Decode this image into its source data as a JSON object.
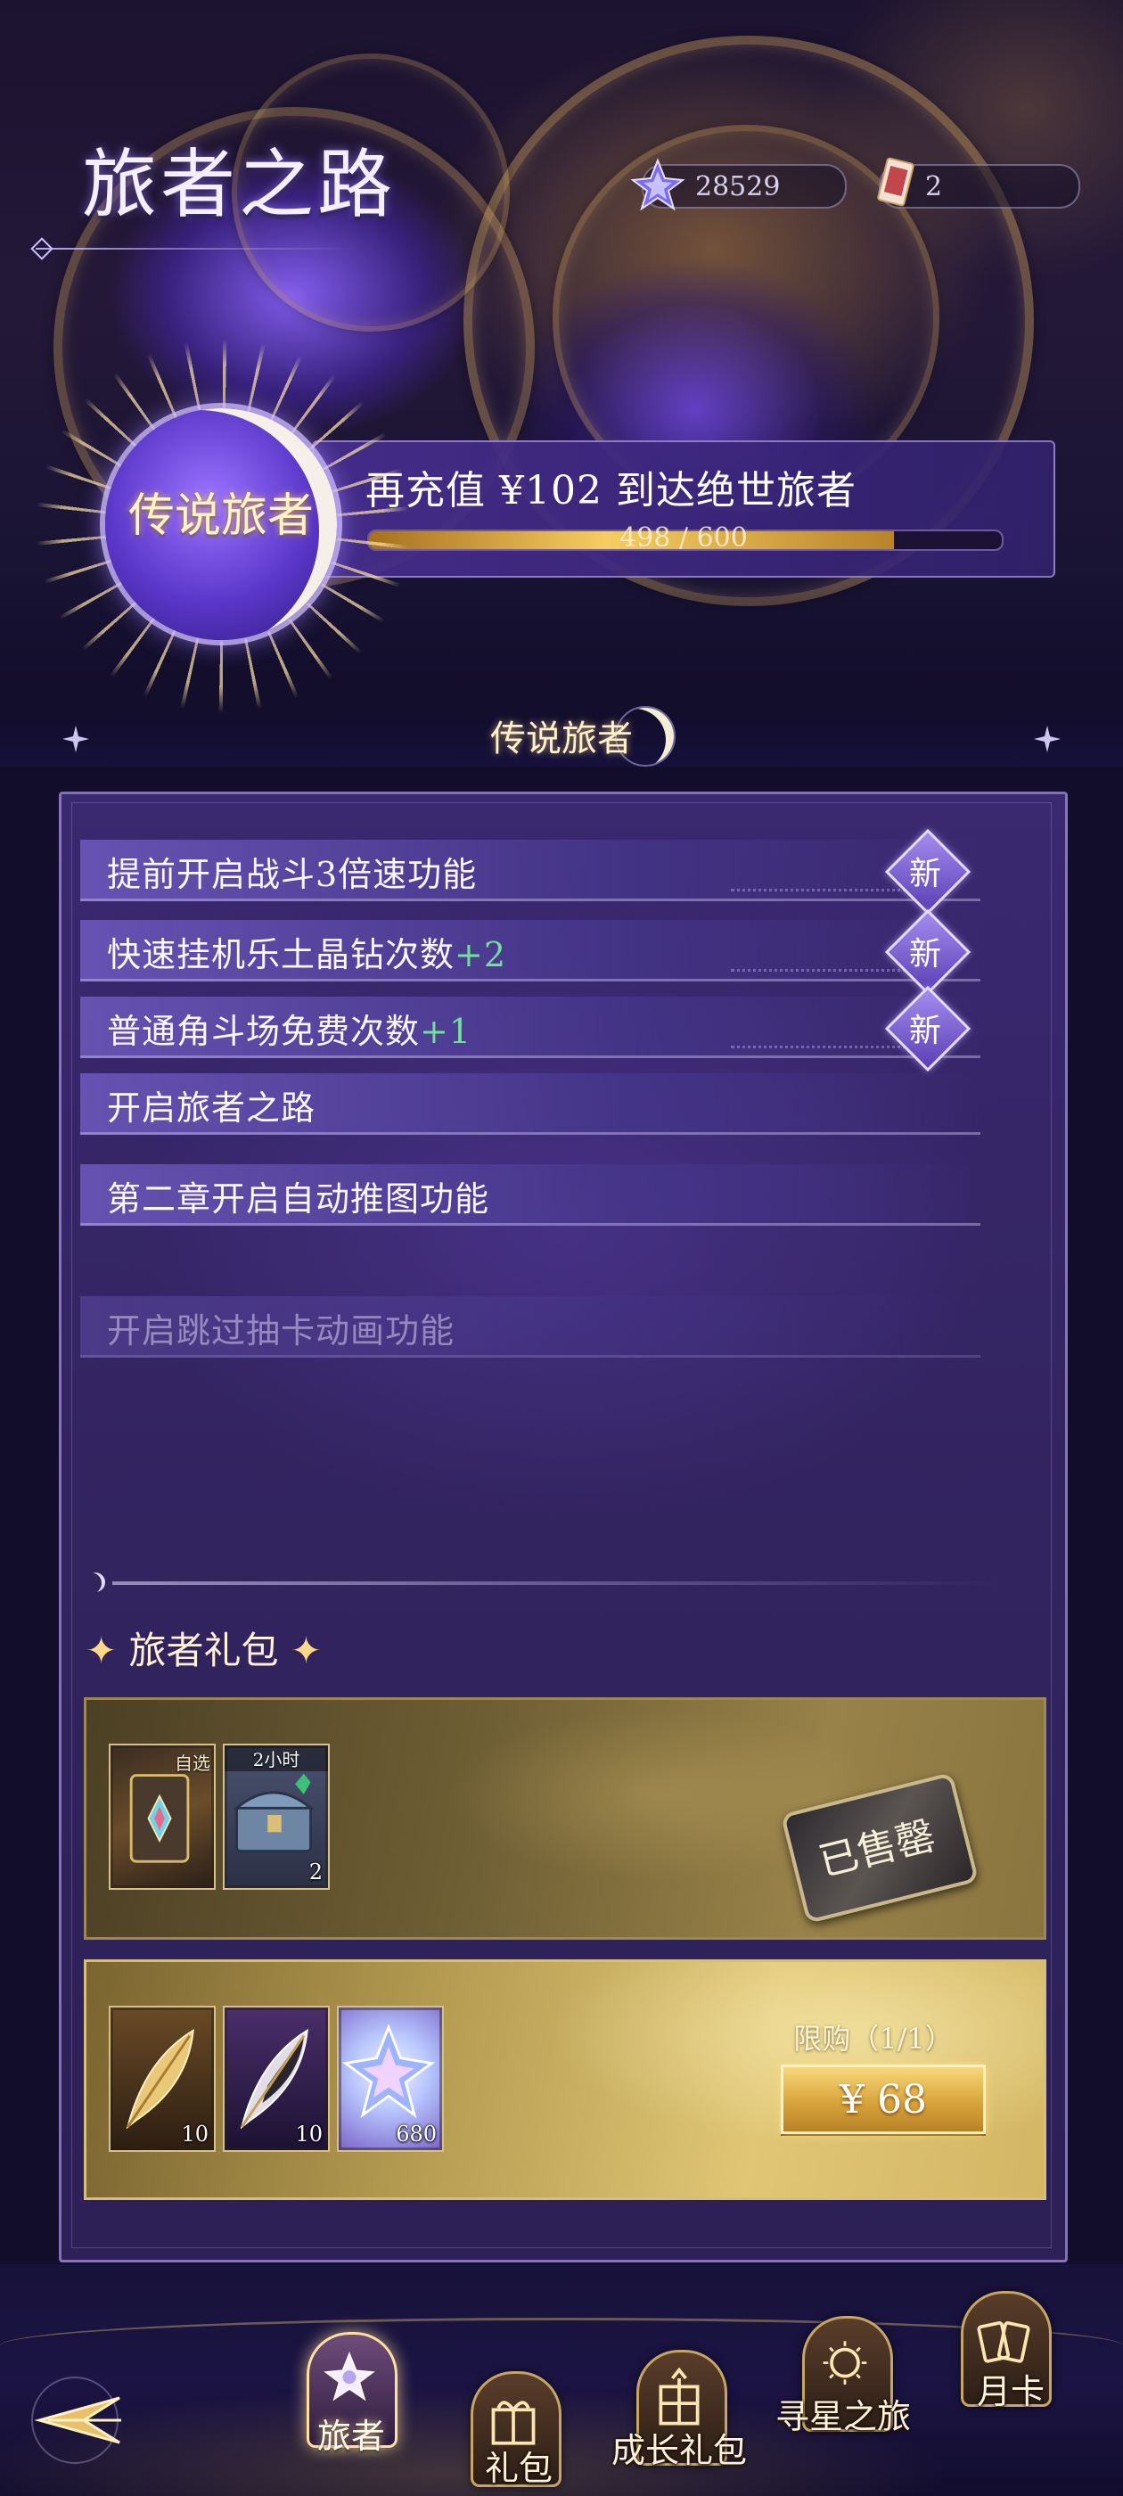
{
  "header": {
    "title": "旅者之路",
    "currencies": [
      {
        "icon": "star-gem-icon",
        "value": "28529"
      },
      {
        "icon": "ticket-icon",
        "value": "2"
      }
    ]
  },
  "vip": {
    "badge": "传说旅者",
    "message": "再充值 ¥102 到达绝世旅者",
    "progress_current": 498,
    "progress_max": 600,
    "progress_text": "498 / 600"
  },
  "section": {
    "title": "传说旅者"
  },
  "benefits": [
    {
      "text": "提前开启战斗3倍速功能",
      "plus": "",
      "is_new": true,
      "new_label": "新"
    },
    {
      "text": "快速挂机乐土晶钻次数",
      "plus": "+2",
      "is_new": true,
      "new_label": "新"
    },
    {
      "text": "普通角斗场免费次数",
      "plus": "+1",
      "is_new": true,
      "new_label": "新"
    },
    {
      "text": "开启旅者之路",
      "plus": "",
      "is_new": false
    },
    {
      "text": "第二章开启自动推图功能",
      "plus": "",
      "is_new": false
    },
    {
      "text": "开启跳过抽卡动画功能",
      "plus": "",
      "is_new": false,
      "dimmed": true
    }
  ],
  "gifts": {
    "title": "旅者礼包",
    "packs": [
      {
        "status": "已售罄",
        "items": [
          {
            "icon": "selectable-card-icon",
            "tag": "自选",
            "count": ""
          },
          {
            "icon": "treasure-chest-icon",
            "tag": "2小时",
            "count": "2"
          }
        ]
      },
      {
        "limit": "限购（1/1）",
        "price": "¥ 68",
        "items": [
          {
            "icon": "golden-feather-icon",
            "count": "10"
          },
          {
            "icon": "dark-feather-icon",
            "count": "10"
          },
          {
            "icon": "star-crystal-icon",
            "count": "680"
          }
        ]
      }
    ]
  },
  "nav": {
    "tabs": [
      {
        "label": "旅者",
        "active": true
      },
      {
        "label": "礼包",
        "active": false
      },
      {
        "label": "成长礼包",
        "active": false
      },
      {
        "label": "寻星之旅",
        "active": false
      },
      {
        "label": "月卡",
        "active": false
      }
    ]
  },
  "colors": {
    "accent_gold": "#f5cd62",
    "panel_purple": "#3a2870",
    "plus_green": "#6fe29a"
  }
}
